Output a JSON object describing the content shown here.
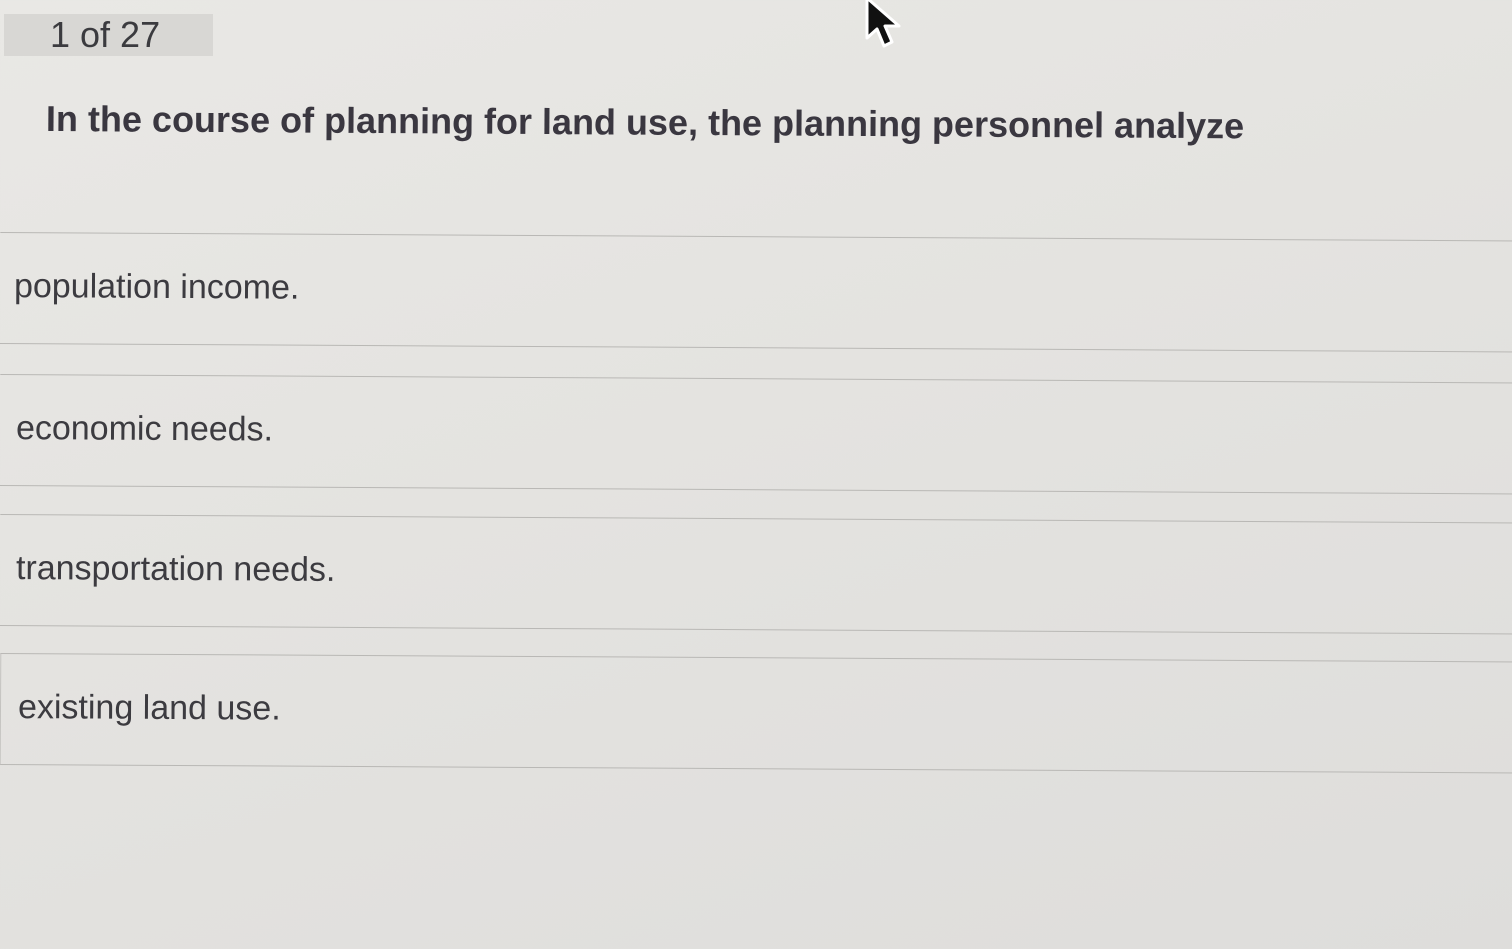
{
  "quiz": {
    "progress_label": "1 of 27",
    "question": "In the course of planning for land use, the planning personnel analyze",
    "options": [
      {
        "label": "population income."
      },
      {
        "label": "economic needs."
      },
      {
        "label": "transportation needs."
      },
      {
        "label": "existing land use."
      }
    ]
  },
  "cursor": {
    "icon": "arrow-cursor-icon"
  }
}
